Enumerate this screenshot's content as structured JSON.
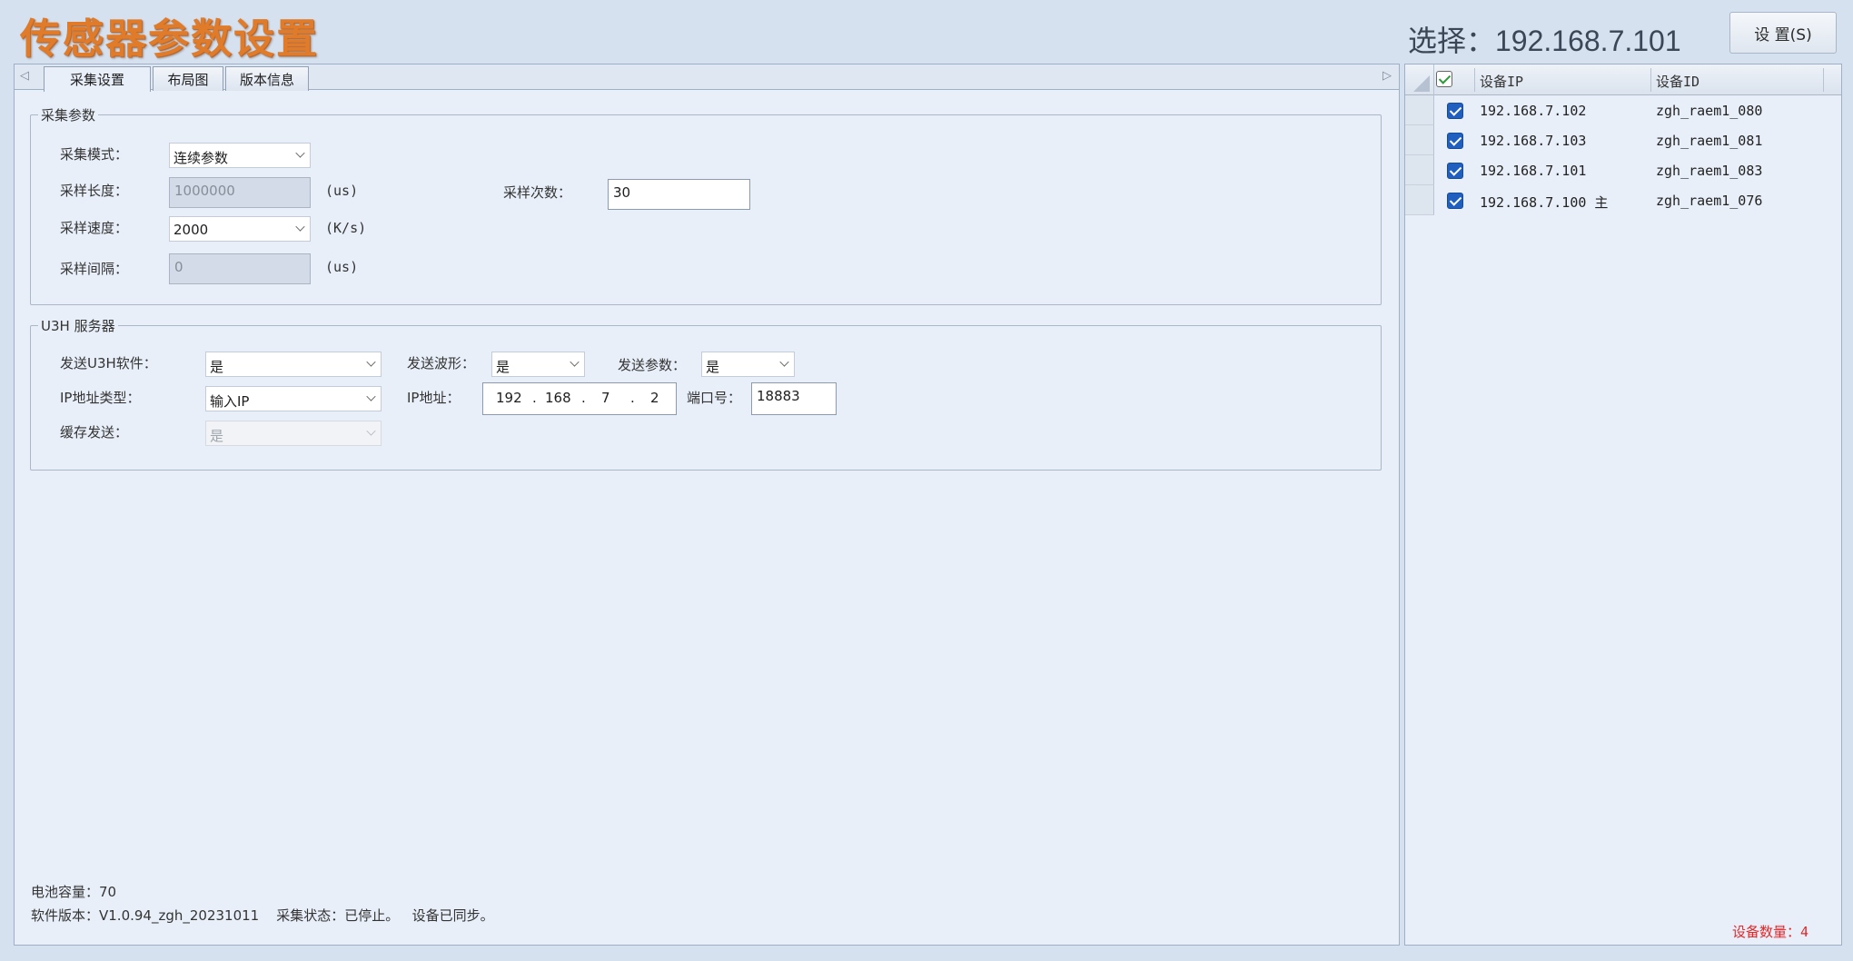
{
  "app": {
    "title": "传感器参数设置"
  },
  "header": {
    "selected_text": "选择：192.168.7.101",
    "settings_button": "设 置(S)"
  },
  "tabs": [
    "采集设置",
    "布局图",
    "版本信息"
  ],
  "acquisition": {
    "legend": "采集参数",
    "mode_label": "采集模式：",
    "mode_value": "连续参数",
    "length_label": "采样长度：",
    "length_value": "1000000",
    "length_unit": "(us)",
    "count_label": "采样次数：",
    "count_value": "30",
    "speed_label": "采样速度：",
    "speed_value": "2000",
    "speed_unit": "(K/s)",
    "interval_label": "采样间隔：",
    "interval_value": "0",
    "interval_unit": "(us)"
  },
  "server": {
    "legend": "U3H 服务器",
    "send_u3h_label": "发送U3H软件：",
    "send_u3h_value": "是",
    "send_wave_label": "发送波形：",
    "send_wave_value": "是",
    "send_param_label": "发送参数：",
    "send_param_value": "是",
    "ip_type_label": "IP地址类型：",
    "ip_type_value": "输入IP",
    "ip_label": "IP地址：",
    "ip_octets": [
      "192",
      "168",
      "7",
      "2"
    ],
    "port_label": "端口号：",
    "port_value": "18883",
    "cache_label": "缓存发送：",
    "cache_value": "是"
  },
  "status": {
    "battery": "电池容量：70",
    "version_line": "软件版本：V1.0.94_zgh_20231011    采集状态：已停止。   设备已同步。"
  },
  "device_grid": {
    "columns": [
      "设备IP",
      "设备ID"
    ],
    "rows": [
      {
        "ip": "192.168.7.102",
        "id": "zgh_raem1_080",
        "checked": true
      },
      {
        "ip": "192.168.7.103",
        "id": "zgh_raem1_081",
        "checked": true
      },
      {
        "ip": "192.168.7.101",
        "id": "zgh_raem1_083",
        "checked": true
      },
      {
        "ip": "192.168.7.100 主",
        "id": "zgh_raem1_076",
        "checked": true
      }
    ],
    "count_text": "设备数量：4"
  }
}
